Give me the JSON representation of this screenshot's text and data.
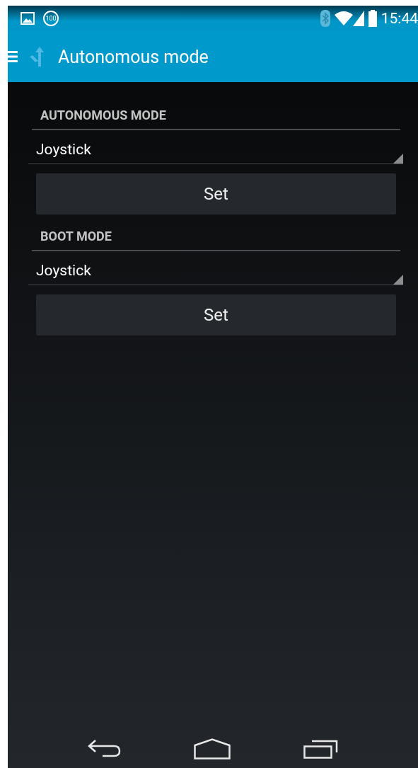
{
  "status_bar": {
    "badge": "100",
    "time": "15:44"
  },
  "action_bar": {
    "title": "Autonomous mode"
  },
  "sections": [
    {
      "heading": "AUTONOMOUS MODE",
      "spinner": {
        "value": "Joystick"
      },
      "button": "Set"
    },
    {
      "heading": "BOOT MODE",
      "spinner": {
        "value": "Joystick"
      },
      "button": "Set"
    }
  ]
}
